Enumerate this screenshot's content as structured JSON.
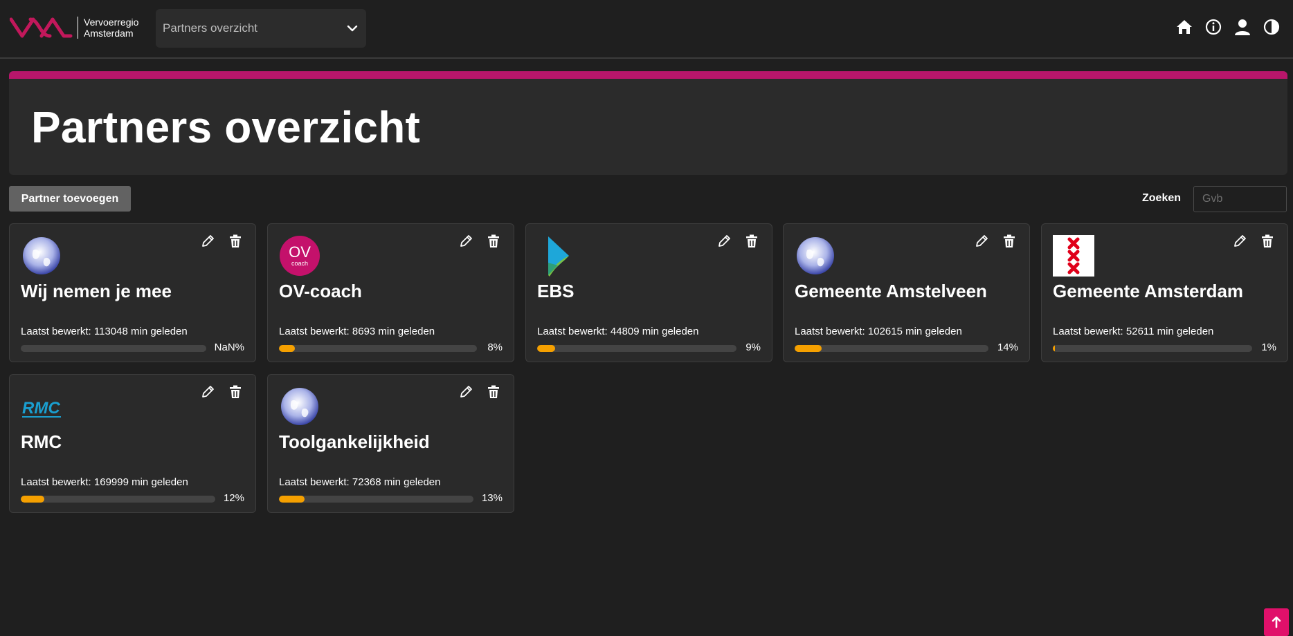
{
  "header": {
    "logo_line1": "Vervoerregio",
    "logo_line2": "Amsterdam",
    "nav_select_value": "Partners overzicht",
    "icons": [
      "home-icon",
      "info-icon",
      "user-icon",
      "contrast-icon"
    ]
  },
  "banner": {
    "title": "Partners overzicht",
    "accent_color": "#b8166b"
  },
  "toolbar": {
    "add_label": "Partner toevoegen",
    "search_label": "Zoeken",
    "search_placeholder": "Gvb",
    "search_value": ""
  },
  "partners": [
    {
      "name": "Wij nemen je mee",
      "logo": "globe-icon",
      "last_edited": "Laatst bewerkt: 113048 min geleden",
      "progress_label": "NaN%",
      "progress": 0
    },
    {
      "name": "OV-coach",
      "logo": "ov-coach-logo",
      "logo_text_main": "OV",
      "logo_text_sub": "coach",
      "last_edited": "Laatst bewerkt: 8693 min geleden",
      "progress_label": "8%",
      "progress": 8
    },
    {
      "name": "EBS",
      "logo": "ebs-logo",
      "last_edited": "Laatst bewerkt: 44809 min geleden",
      "progress_label": "9%",
      "progress": 9
    },
    {
      "name": "Gemeente Amstelveen",
      "logo": "globe-icon",
      "last_edited": "Laatst bewerkt: 102615 min geleden",
      "progress_label": "14%",
      "progress": 14
    },
    {
      "name": "Gemeente Amsterdam",
      "logo": "amsterdam-xxx-logo",
      "last_edited": "Laatst bewerkt: 52611 min geleden",
      "progress_label": "1%",
      "progress": 1
    },
    {
      "name": "RMC",
      "logo": "rmc-logo",
      "logo_text": "RMC",
      "last_edited": "Laatst bewerkt: 169999 min geleden",
      "progress_label": "12%",
      "progress": 12
    },
    {
      "name": "Toolgankelijkheid",
      "logo": "globe-icon",
      "last_edited": "Laatst bewerkt: 72368 min geleden",
      "progress_label": "13%",
      "progress": 13
    }
  ],
  "colors": {
    "progress_fill": "#f5a000",
    "scroll_top_button": "#e0106a"
  }
}
